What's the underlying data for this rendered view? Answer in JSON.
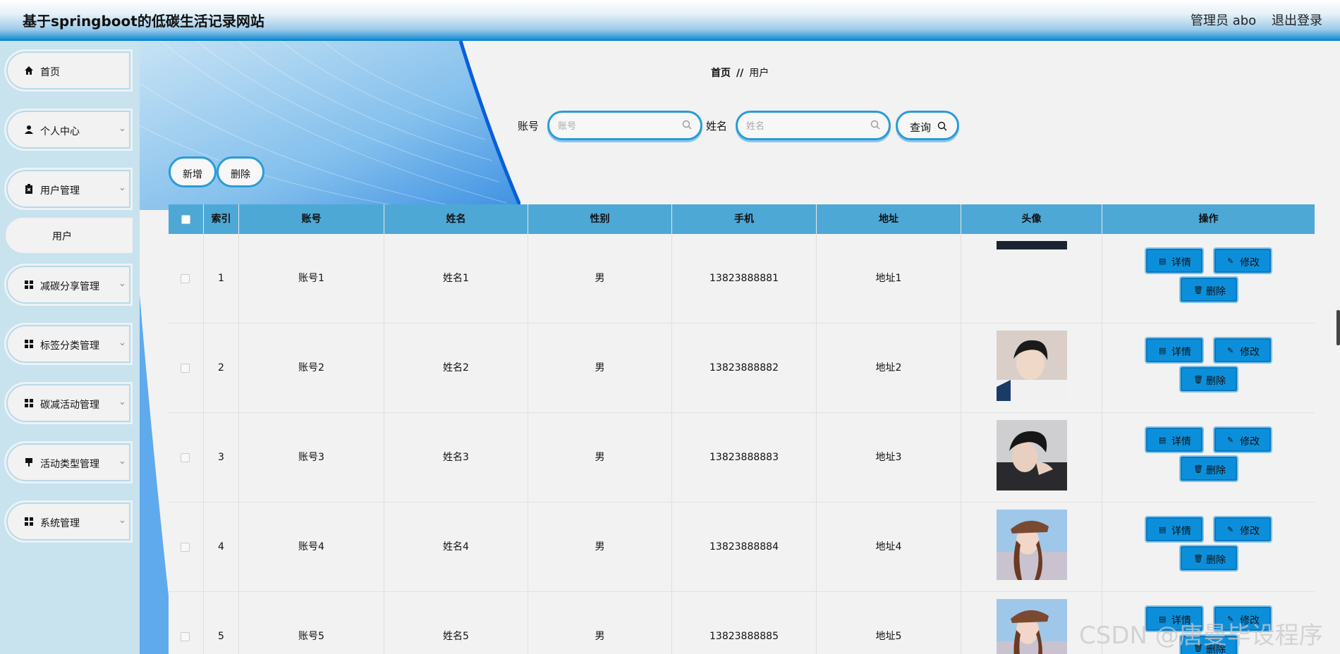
{
  "header": {
    "title": "基于springboot的低碳生活记录网站",
    "user": "管理员 abo",
    "logout": "退出登录"
  },
  "sidebar": {
    "items": [
      {
        "label": "首页",
        "icon": "home-icon"
      },
      {
        "label": "个人中心",
        "icon": "person-icon"
      },
      {
        "label": "用户管理",
        "icon": "clipboard-icon"
      },
      {
        "label": "用户",
        "icon": ""
      },
      {
        "label": "减碳分享管理",
        "icon": "grid-icon"
      },
      {
        "label": "标签分类管理",
        "icon": "grid-icon"
      },
      {
        "label": "碳减活动管理",
        "icon": "grid-icon"
      },
      {
        "label": "活动类型管理",
        "icon": "pin-icon"
      },
      {
        "label": "系统管理",
        "icon": "grid-icon"
      }
    ]
  },
  "breadcrumb": {
    "home": "首页",
    "separator": "//",
    "current": "用户"
  },
  "search": {
    "account_label": "账号",
    "account_placeholder": "账号",
    "name_label": "姓名",
    "name_placeholder": "姓名",
    "query_label": "查询"
  },
  "actions": {
    "add": "新增",
    "delete": "删除"
  },
  "table": {
    "columns": [
      "索引",
      "账号",
      "姓名",
      "性别",
      "手机",
      "地址",
      "头像",
      "操作"
    ],
    "rows": [
      {
        "index": "1",
        "account": "账号1",
        "name": "姓名1",
        "gender": "男",
        "phone": "13823888881",
        "address": "地址1"
      },
      {
        "index": "2",
        "account": "账号2",
        "name": "姓名2",
        "gender": "男",
        "phone": "13823888882",
        "address": "地址2"
      },
      {
        "index": "3",
        "account": "账号3",
        "name": "姓名3",
        "gender": "男",
        "phone": "13823888883",
        "address": "地址3"
      },
      {
        "index": "4",
        "account": "账号4",
        "name": "姓名4",
        "gender": "男",
        "phone": "13823888884",
        "address": "地址4"
      },
      {
        "index": "5",
        "account": "账号5",
        "name": "姓名5",
        "gender": "男",
        "phone": "13823888885",
        "address": "地址5"
      }
    ],
    "op_detail": "详情",
    "op_edit": "修改",
    "op_delete": "删除"
  },
  "watermark": "CSDN @唐曼毕设程序",
  "colors": {
    "accent": "#0c8fdb",
    "header_bg": "#4ea8d6",
    "sidebar_bg": "#c8e2ee"
  }
}
